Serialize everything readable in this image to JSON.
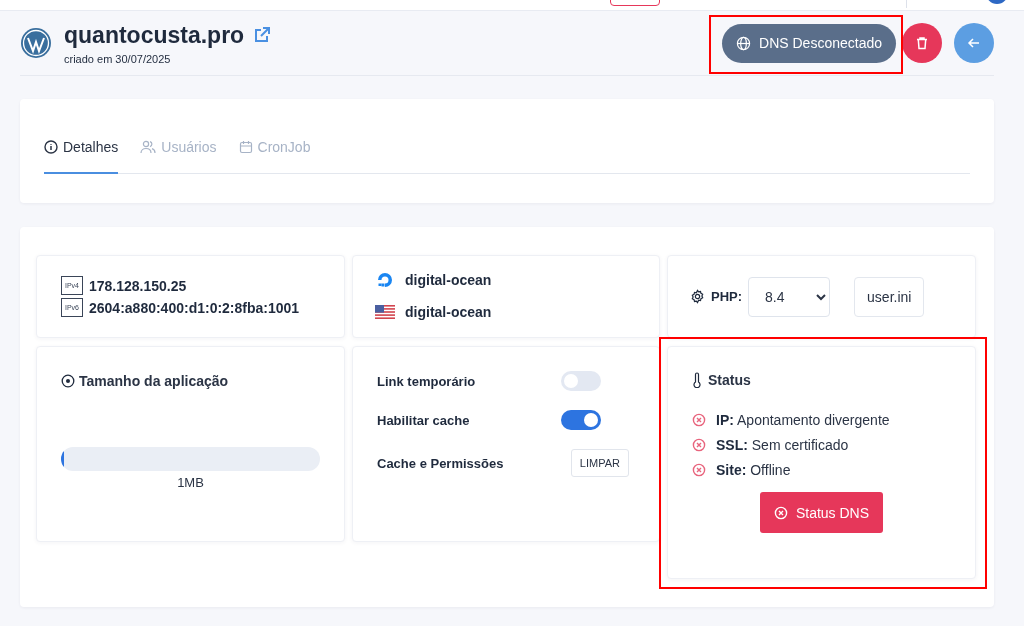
{
  "site": {
    "title": "quantocusta.pro",
    "created": "criado em 30/07/2025"
  },
  "dns_button": {
    "label": "DNS Desconectado",
    "highlighted": true
  },
  "tabs": [
    {
      "label": "Detalhes",
      "selected": true,
      "kind": "info"
    },
    {
      "label": "Usuários",
      "selected": false,
      "kind": "users"
    },
    {
      "label": "CronJob",
      "selected": false,
      "kind": "calendar"
    }
  ],
  "addresses": [
    {
      "tag": "IPv4",
      "value": "178.128.150.25"
    },
    {
      "tag": "IPv6",
      "value": "2604:a880:400:d1:0:2:8fba:1001"
    }
  ],
  "provider": [
    {
      "kind": "logo",
      "name": "digital-ocean"
    },
    {
      "kind": "flag",
      "name": "digital-ocean"
    }
  ],
  "php": {
    "label": "PHP:",
    "version": "8.4",
    "config_button": "user.ini"
  },
  "app_size": {
    "title": "Tamanho da aplicação",
    "level": 0.01,
    "reading": "1MB"
  },
  "settings": [
    {
      "kind": "toggle",
      "label": "Link temporário",
      "on": false
    },
    {
      "kind": "toggle",
      "label": "Habilitar cache",
      "on": true
    },
    {
      "kind": "action",
      "label": "Cache e Permissões",
      "button": "LIMPAR"
    }
  ],
  "status": {
    "title": "Status",
    "highlighted": true,
    "checks": [
      {
        "name": "IP:",
        "value": "Apontamento divergente",
        "ok": false
      },
      {
        "name": "SSL:",
        "value": "Sem certificado",
        "ok": false
      },
      {
        "name": "Site:",
        "value": "Offline",
        "ok": false
      }
    ],
    "button": "Status DNS"
  }
}
